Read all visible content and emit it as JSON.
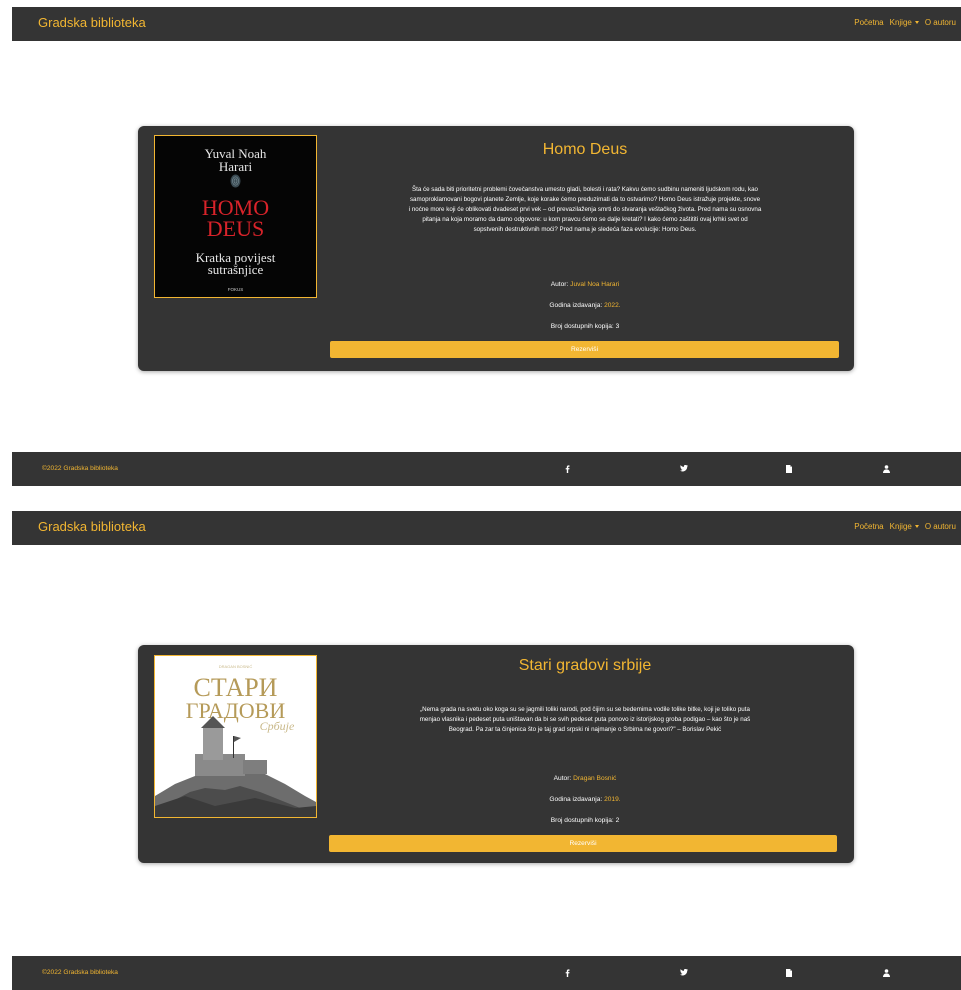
{
  "nav": {
    "brand": "Gradska biblioteka",
    "home": "Početna",
    "books": "Knjige",
    "about": "O autoru"
  },
  "books": [
    {
      "title": "Homo Deus",
      "cover": {
        "author_line1": "Yuval Noah",
        "author_line2": "Harari",
        "title_line1": "HOMO",
        "title_line2": "DEUS",
        "subtitle_line1": "Kratka povijest",
        "subtitle_line2": "sutrašnjice",
        "publisher": "FOKUS"
      },
      "description_lines": [
        "Šta će sada biti prioritetni problemi čovečanstva umesto gladi, bolesti i rata? Kakvu ćemo sudbinu nameniti ljudskom rodu, kao",
        "samoproklamovani bogovi planete Zemlje, koje korake ćemo preduzimati da to ostvarimo? Homo Deus istražuje projekte, snove",
        "i noćne more koji će oblikovati dvadeset prvi vek – od prevazilaženja smrti do stvaranja veštačkog života. Pred nama su osnovna",
        "pitanja na koja moramo da damo odgovore: u kom pravcu ćemo se dalje kretati? I kako ćemo zaštititi ovaj krhki svet od",
        "sopstvenih destruktivnih moći? Pred nama je sledeća faza evolucije: Homo Deus."
      ],
      "author_label": "Autor:",
      "author": "Juval Noa Harari",
      "year_label": "Godina izdavanja:",
      "year": "2022.",
      "copies_label": "Broj dostupnih kopija:",
      "copies": "3",
      "reserve": "Rezerviši"
    },
    {
      "title": "Stari gradovi srbije",
      "cover": {
        "top_small": "DRAGAN BOSNIĆ",
        "title_line1": "СТАРИ",
        "title_line2": "ГРАДОВИ",
        "title_line3": "Србије"
      },
      "description_lines": [
        "„Nema grada na svetu oko koga su se jagmili toliki narodi, pod čijim su se bedemima vodile tolike bitke, koji je toliko puta",
        "menjao vlasnika i pedeset puta uništavan da bi se svih pedeset puta ponovo iz istorijskog groba podigao – kao što je naš",
        "Beograd. Pa zar ta činjenica što je taj grad srpski ni najmanje o Srbima ne govori?\" – Borislav Pekić"
      ],
      "author_label": "Autor:",
      "author": "Dragan Bosnić",
      "year_label": "Godina izdavanja:",
      "year": "2019.",
      "copies_label": "Broj dostupnih kopija:",
      "copies": "2",
      "reserve": "Rezerviši"
    }
  ],
  "footer": {
    "copyright": "©2022 Gradska biblioteka",
    "icons": [
      "facebook-icon",
      "twitter-icon",
      "file-icon",
      "user-icon"
    ]
  },
  "colors": {
    "accent": "#f2b632",
    "dark": "#343434",
    "cover_red": "#d8232a"
  }
}
